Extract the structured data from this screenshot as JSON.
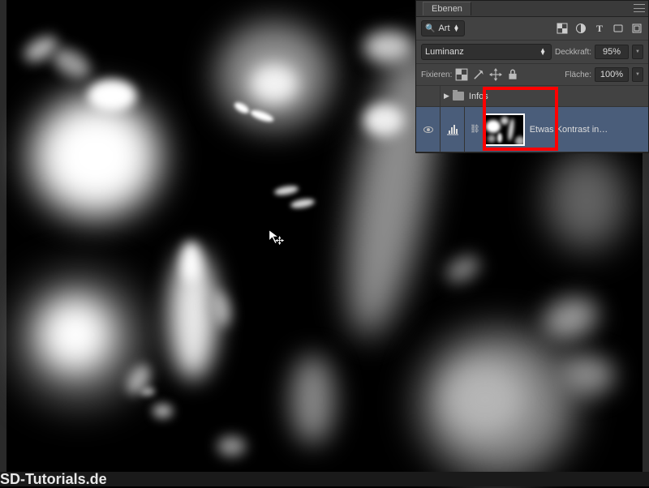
{
  "panel": {
    "title": "Ebenen",
    "filter": {
      "label": "Art"
    },
    "blendmode": {
      "selected": "Luminanz"
    },
    "opacity": {
      "label": "Deckkraft:",
      "value": "95%"
    },
    "lock": {
      "label": "Fixieren:"
    },
    "fill": {
      "label": "Fläche:",
      "value": "100%"
    },
    "layers": {
      "group": {
        "name": "Infos"
      },
      "adjustment": {
        "name": "Etwas Kontrast in…"
      }
    }
  },
  "footer": "SD-Tutorials.de"
}
